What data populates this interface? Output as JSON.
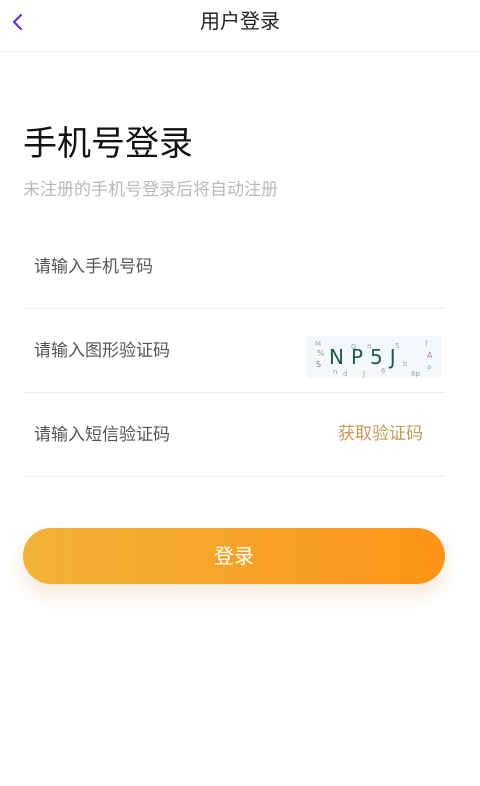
{
  "navbar": {
    "title": "用户登录",
    "back_icon": "chevron-left-icon",
    "back_icon_color": "#6b2fd6"
  },
  "heading": {
    "title": "手机号登录",
    "subtitle": "未注册的手机号登录后将自动注册"
  },
  "form": {
    "phone": {
      "placeholder": "请输入手机号码",
      "value": ""
    },
    "captcha": {
      "placeholder": "请输入图形验证码",
      "value": "",
      "image_text": "NP5J"
    },
    "sms": {
      "placeholder": "请输入短信验证码",
      "value": "",
      "get_code_label": "获取验证码"
    }
  },
  "login_button": {
    "label": "登录"
  },
  "colors": {
    "accent_start": "#f0b338",
    "accent_end": "#fd9418",
    "link": "#c79a55"
  }
}
